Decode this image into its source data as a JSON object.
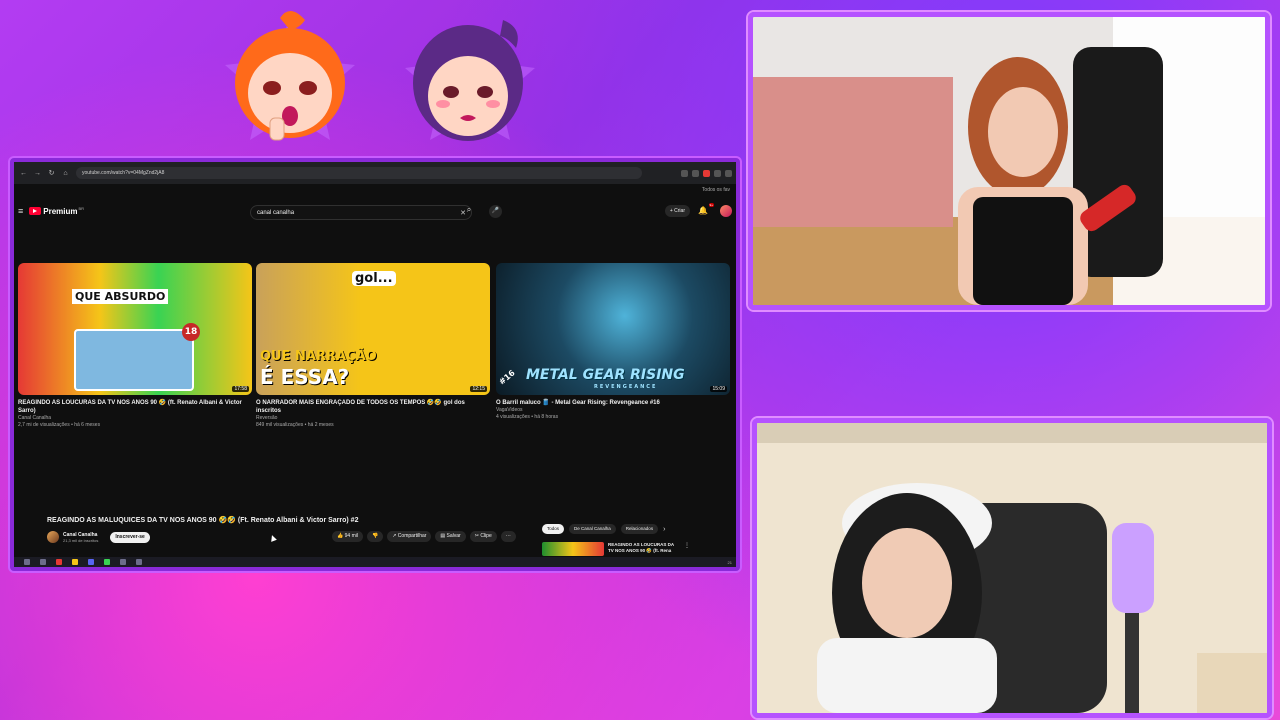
{
  "browser": {
    "url": "youtube.com/watch?v=04MgZnd2jA8",
    "bookmarks_label": "Todos os fav"
  },
  "youtube": {
    "logo_text": "Premium",
    "logo_sup": "BR",
    "search_value": "canal canalha",
    "create_label": "Criar",
    "notif_count": "9+"
  },
  "cards": [
    {
      "title": "REAGINDO AS LOUCURAS DA TV NOS ANOS 90 🤣 (ft. Renato Albani & Victor Sarro)",
      "channel": "Canal Canalha",
      "meta": "2,7 mi de visualizações • há 6 meses",
      "duration": "17:58",
      "overlay": "QUE ABSURDO",
      "badge": "18"
    },
    {
      "title": "O NARRADOR MAIS ENGRAÇADO DE TODOS OS TEMPOS 🤣🤣 gol dos inscritos",
      "channel": "Reversão",
      "meta": "849 mil visualizações • há 2 meses",
      "duration": "12:15",
      "overlay_top": "gol...",
      "overlay": "QUE NARRAÇÃO",
      "overlay2": "É ESSA?"
    },
    {
      "title": "O Barril maluco 🛢️ - Metal Gear Rising: Revengeance #16",
      "channel": "VagaVideos",
      "meta": "4 visualizações • há 8 horas",
      "duration": "15:09",
      "overlay": "METAL GEAR RISING",
      "overlay_sub": "REVENGEANCE",
      "tag": "#16"
    }
  ],
  "video": {
    "title": "REAGINDO AS MALUQUICES DA TV NOS ANOS 90 🤣🤣 (Ft. Renato Albani & Victor Sarro) #2",
    "channel": "Canal Canalha",
    "subs": "21,3 mil de inscritos",
    "subscribe_label": "Inscrever-se",
    "likes": "94 mil",
    "share_label": "Compartilhar",
    "save_label": "Salvar",
    "clip_label": "Clipe",
    "more_label": "···"
  },
  "recommendations": {
    "chips": [
      "Todos",
      "De Canal Canalha",
      "Relacionados"
    ],
    "first_title": "REAGINDO AS LOUCURAS DA TV NOS ANOS 90 🤣 (ft. Rena"
  },
  "taskbar": {
    "clock": "21"
  },
  "colors": {
    "frame": "#8a2ad9",
    "youtube_red": "#ff0033",
    "background_pink": "#e94ad9",
    "background_purple": "#9b2fe0"
  }
}
